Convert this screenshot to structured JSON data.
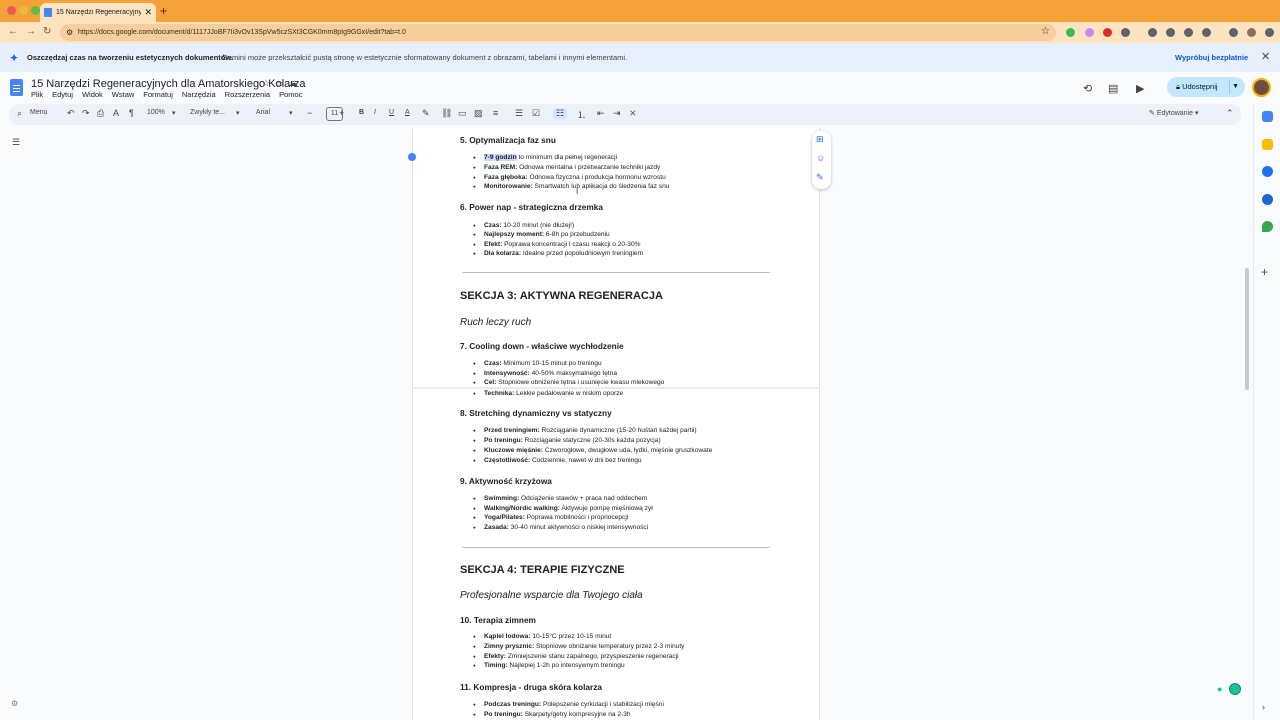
{
  "browser": {
    "tab_title": "15 Narzędzi Regeneracyjnych dla Amatorskiego Kolarza",
    "url": "https://docs.google.com/document/d/1117JJoBF7Ii3vOv13SpVw5czSXt3CGK0mm8pIg9GGxI/edit?tab=t.0"
  },
  "banner": {
    "title": "Oszczędzaj czas na tworzeniu estetycznych dokumentów.",
    "text": "Gemini może przekształcić pustą stronę w estetycznie sformatowany dokument z obrazami, tabelami i innymi elementami.",
    "cta": "Wypróbuj bezpłatnie"
  },
  "doc": {
    "title": "15 Narzędzi Regeneracyjnych dla Amatorskiego Kolarza",
    "menu": [
      "Plik",
      "Edytuj",
      "Widok",
      "Wstaw",
      "Formatuj",
      "Narzędzia",
      "Rozszerzenia",
      "Pomoc"
    ],
    "share_label": "Udostępnij"
  },
  "toolbar": {
    "search": "Menu",
    "zoom": "100%",
    "style": "Zwykły te...",
    "font": "Arial",
    "font_size": "11",
    "mode": "Edytowanie"
  },
  "content": {
    "s5_title": "5. Optymalizacja faz snu",
    "s5_b1_k": "7-9 godzin",
    "s5_b1_v": " to minimum dla pełnej regeneracji",
    "s5_b2_k": "Faza REM:",
    "s5_b2_v": " Odnowa mentalna i przetwarzanie techniki jazdy",
    "s5_b3_k": "Faza głęboka:",
    "s5_b3_v": " Odnowa fizyczna i produkcja hormonu wzrostu",
    "s5_b4_k": "Monitorowanie:",
    "s5_b4_v": " Smartwatch lub aplikacja do śledzenia faz snu",
    "s6_title": "6. Power nap - strategiczna drzemka",
    "s6_b1_k": "Czas:",
    "s6_b1_v": " 10-20 minut (nie dłużej!)",
    "s6_b2_k": "Najlepszy moment:",
    "s6_b2_v": " 6-8h po przebudzeniu",
    "s6_b3_k": "Efekt:",
    "s6_b3_v": " Poprawa koncentracji i czasu reakcji o 20-30%",
    "s6_b4_k": "Dla kolarza:",
    "s6_b4_v": " Idealne przed popołudniowym treningiem",
    "sec3_title": "SEKCJA 3: AKTYWNA REGENERACJA",
    "sec3_sub": "Ruch leczy ruch",
    "s7_title": "7. Cooling down - właściwe wychłodzenie",
    "s7_b1_k": "Czas:",
    "s7_b1_v": " Minimum 10-15 minut po treningu",
    "s7_b2_k": "Intensywność:",
    "s7_b2_v": " 40-50% maksymalnego tętna",
    "s7_b3_k": "Cel:",
    "s7_b3_v": " Stopniowe obniżenie tętna i usunięcie kwasu mlekowego",
    "s7_b4_k": "Technika:",
    "s7_b4_v": " Lekkie pedałowanie w niskim oporze",
    "s8_title": "8. Stretching dynamiczny vs statyczny",
    "s8_b1_k": "Przed treningiem:",
    "s8_b1_v": " Rozciąganie dynamiczne (15-20 huśtań każdej partii)",
    "s8_b2_k": "Po treningu:",
    "s8_b2_v": " Rozciąganie statyczne (20-30s każda pozycja)",
    "s8_b3_k": "Kluczowe mięśnie:",
    "s8_b3_v": " Czworogłowe, dwugłowe uda, łydki, mięśnie gruszkowate",
    "s8_b4_k": "Częstotliwość:",
    "s8_b4_v": " Codziennie, nawet w dni bez treningu",
    "s9_title": "9. Aktywność krzyżowa",
    "s9_b1_k": "Swimming:",
    "s9_b1_v": " Odciążenie stawów + praca nad oddechem",
    "s9_b2_k": "Walking/Nordic walking:",
    "s9_b2_v": " Aktywuje pompę mięśniową żył",
    "s9_b3_k": "Yoga/Pilates:",
    "s9_b3_v": " Poprawa mobilności i propriocepcji",
    "s9_b4_k": "Zasada:",
    "s9_b4_v": " 30-40 minut aktywności o niskiej intensywności",
    "sec4_title": "SEKCJA 4: TERAPIE FIZYCZNE",
    "sec4_sub": "Profesjonalne wsparcie dla Twojego ciała",
    "s10_title": "10. Terapia zimnem",
    "s10_b1_k": "Kąpiel lodowa:",
    "s10_b1_v": " 10-15°C przez 10-15 minut",
    "s10_b2_k": "Zimny prysznic:",
    "s10_b2_v": " Stopniowe obniżanie temperatury przez 2-3 minuty",
    "s10_b3_k": "Efekty:",
    "s10_b3_v": " Zmniejszenie stanu zapalnego, przyspieszenie regeneracji",
    "s10_b4_k": "Timing:",
    "s10_b4_v": " Najlepiej 1-2h po intensywnym treningu",
    "s11_title": "11. Kompresja - druga skóra kolarza",
    "s11_b1_k": "Podczas treningu:",
    "s11_b1_v": " Polepszenie cyrkulacji i stabilizacji mięśni",
    "s11_b2_k": "Po treningu:",
    "s11_b2_v": " Skarpety/getry kompresyjne na 2-3h"
  }
}
